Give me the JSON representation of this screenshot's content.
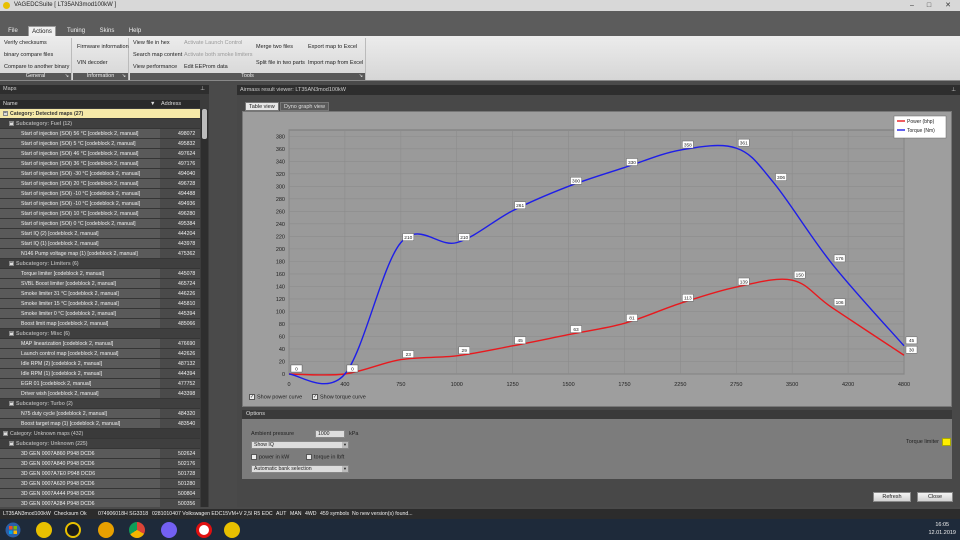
{
  "window": {
    "title": "VAGEDCSuite [ LT35AN3mod100kW ]",
    "controls": [
      "–",
      "□",
      "✕"
    ]
  },
  "ribbon": {
    "tabs": [
      {
        "label": "File",
        "active": false
      },
      {
        "label": "Actions",
        "active": true
      },
      {
        "label": "Tuning",
        "active": false
      },
      {
        "label": "Skins",
        "active": false
      },
      {
        "label": "Help",
        "active": false
      }
    ],
    "general": {
      "label": "General",
      "items": [
        "Verify checksums",
        "binary compare files",
        "Compare to another binary"
      ]
    },
    "information": {
      "label": "Information",
      "items": [
        "Firmware information",
        "VIN decoder"
      ]
    },
    "tools": {
      "label": "Tools",
      "col1": [
        "View file in hex",
        "Search map content",
        "View performance"
      ],
      "col2": [
        "Activate Launch Control",
        "Activate both smoke limiters",
        "Edit EEProm data"
      ],
      "col3": [
        "Merge two files",
        "Split file in two parts"
      ],
      "col4": [
        "Export map to Excel",
        "Import map from Excel"
      ]
    }
  },
  "maps_panel": {
    "title": "Maps",
    "col_name": "Name",
    "col_address": "Address",
    "rows": [
      {
        "type": "category",
        "label": "Category: Detected maps (27)",
        "hl": true
      },
      {
        "type": "subcat",
        "label": "Subcategory: Fuel (12)"
      },
      {
        "type": "item",
        "name": "Start of injection (SOI) 56 °C [codeblock 2, manual]",
        "address": "498072"
      },
      {
        "type": "item",
        "name": "Start of injection (SOI) 5 °C [codeblock 2, manual]",
        "address": "495832"
      },
      {
        "type": "item",
        "name": "Start of injection (SOI) 46 °C [codeblock 2, manual]",
        "address": "497624"
      },
      {
        "type": "item",
        "name": "Start of injection (SOI) 36 °C [codeblock 2, manual]",
        "address": "497176"
      },
      {
        "type": "item",
        "name": "Start of injection (SOI) -30 °C [codeblock 2, manual]",
        "address": "494040"
      },
      {
        "type": "item",
        "name": "Start of injection (SOI) 20 °C [codeblock 2, manual]",
        "address": "496728"
      },
      {
        "type": "item",
        "name": "Start of injection (SOI) -10 °C [codeblock 2, manual]",
        "address": "494488"
      },
      {
        "type": "item",
        "name": "Start of injection (SOI) -10 °C [codeblock 2, manual]",
        "address": "494936"
      },
      {
        "type": "item",
        "name": "Start of injection (SOI) 10 °C [codeblock 2, manual]",
        "address": "496280"
      },
      {
        "type": "item",
        "name": "Start of injection (SOI) 0 °C [codeblock 2, manual]",
        "address": "495384"
      },
      {
        "type": "item",
        "name": "Start IQ (2) [codeblock 2, manual]",
        "address": "444204"
      },
      {
        "type": "item",
        "name": "Start IQ (1) [codeblock 2, manual]",
        "address": "443978"
      },
      {
        "type": "item",
        "name": "N146 Pump voltage map (1) [codeblock 2, manual]",
        "address": "475362"
      },
      {
        "type": "subcat",
        "label": "Subcategory: Limiters (6)"
      },
      {
        "type": "item",
        "name": "Torque limiter [codeblock 2, manual]",
        "address": "445078"
      },
      {
        "type": "item",
        "name": "SVBL Boost limiter [codeblock 2, manual]",
        "address": "465724"
      },
      {
        "type": "item",
        "name": "Smoke limiter 31 °C [codeblock 2, manual]",
        "address": "446226"
      },
      {
        "type": "item",
        "name": "Smoke limiter 15 °C [codeblock 2, manual]",
        "address": "445810"
      },
      {
        "type": "item",
        "name": "Smoke limiter 0 °C [codeblock 2, manual]",
        "address": "445394"
      },
      {
        "type": "item",
        "name": "Boost limit map [codeblock 2, manual]",
        "address": "485066"
      },
      {
        "type": "subcat",
        "label": "Subcategory: Misc (6)"
      },
      {
        "type": "item",
        "name": "MAP linearization [codeblock 2, manual]",
        "address": "476690"
      },
      {
        "type": "item",
        "name": "Launch control map [codeblock 2, manual]",
        "address": "442626"
      },
      {
        "type": "item",
        "name": "Idle RPM (2) [codeblock 2, manual]",
        "address": "487132"
      },
      {
        "type": "item",
        "name": "Idle RPM (1) [codeblock 2, manual]",
        "address": "444394"
      },
      {
        "type": "item",
        "name": "EGR 01 [codeblock 2, manual]",
        "address": "477752"
      },
      {
        "type": "item",
        "name": "Driver wish [codeblock 2, manual]",
        "address": "443398"
      },
      {
        "type": "subcat",
        "label": "Subcategory: Turbo (2)"
      },
      {
        "type": "item",
        "name": "N75 duty cycle [codeblock 2, manual]",
        "address": "484320"
      },
      {
        "type": "item",
        "name": "Boost target map (1) [codeblock 2, manual]",
        "address": "483540"
      },
      {
        "type": "category",
        "label": "Category: Unknown maps (432)",
        "hl": false
      },
      {
        "type": "subcat",
        "label": "Subcategory: Unknown (225)"
      },
      {
        "type": "item",
        "name": "3D GEN 0007A860 P948 DCD6",
        "address": "502624"
      },
      {
        "type": "item",
        "name": "3D GEN 0007A840 P948 DCD6",
        "address": "502176"
      },
      {
        "type": "item",
        "name": "3D GEN 0007A7E0 P948 DCD6",
        "address": "501728"
      },
      {
        "type": "item",
        "name": "3D GEN 0007A620 P948 DCD6",
        "address": "501280"
      },
      {
        "type": "item",
        "name": "3D GEN 0007A444 P948 DCD6",
        "address": "500804"
      },
      {
        "type": "item",
        "name": "3D GEN 0007A284 P948 DCD6",
        "address": "500356"
      }
    ]
  },
  "viewer": {
    "title": "Airmass result viewer: LT35AN3mod100kW",
    "tabs": [
      {
        "label": "Table view",
        "active": true
      },
      {
        "label": "Dyno graph view",
        "active": false
      }
    ],
    "show_power_label": "Show power curve",
    "show_torque_label": "Show torque curve",
    "options_title": "Options",
    "ambient_label": "Ambient pressure",
    "ambient_value": "1000",
    "ambient_unit": "kPa",
    "show_iq_value": "Show IQ",
    "power_kw_label": "power in kW",
    "torque_lbft_label": "torque in lbft",
    "bank_value": "Automatic bank selection",
    "torque_limiter_label": "Torque limiter",
    "torque_limiter_color": "#ffee00",
    "refresh_label": "Refresh",
    "close_label": "Close"
  },
  "chart_data": {
    "type": "line",
    "x": [
      0,
      400,
      500,
      750,
      1000,
      1250,
      1500,
      1750,
      2250,
      2500,
      3000,
      3500,
      4200,
      4800
    ],
    "power_x": [
      0,
      400,
      750,
      1000,
      1250,
      1500,
      1750,
      2250,
      2750,
      3500,
      4000,
      4800
    ],
    "torque_x": [
      0,
      400,
      750,
      1000,
      1250,
      1500,
      1750,
      2250,
      2750,
      3250,
      4000,
      4800
    ],
    "xticks": [
      "0",
      "400",
      "750",
      "1000",
      "1250",
      "1500",
      "1750",
      "2250",
      "2750",
      "3500",
      "4200",
      "4800"
    ],
    "yticks": [
      "0",
      "20",
      "40",
      "60",
      "80",
      "100",
      "120",
      "140",
      "160",
      "180",
      "200",
      "220",
      "240",
      "260",
      "280",
      "300",
      "320",
      "340",
      "360",
      "380"
    ],
    "ylim": [
      0,
      390
    ],
    "series": [
      {
        "name": "Power (bhp)",
        "color": "#e8191e",
        "values": [
          0,
          0,
          23,
          29,
          45,
          63,
          81,
          113,
          139,
          150,
          106,
          30
        ],
        "labels": [
          "0",
          "0",
          "23",
          "29",
          "45",
          "63",
          "81",
          "113",
          "139",
          "150",
          "106",
          "30"
        ]
      },
      {
        "name": "Torque (Nm)",
        "color": "#1e1ee8",
        "values": [
          0,
          0,
          210,
          210,
          261,
          300,
          330,
          358,
          361,
          306,
          176,
          45
        ],
        "labels": [
          "0",
          "0",
          "210",
          "210",
          "261",
          "300",
          "330",
          "358",
          "361",
          "306",
          "176",
          "45"
        ]
      }
    ],
    "legend": "top-right"
  },
  "statusbar": {
    "file": "LT35AN3mod100kW",
    "checksum": "Checksum Ok",
    "ecu": "074906018H SG3318",
    "ecu_info": "0281010407 Volkswagen EDC15VM+V 2,5l R5 EDC",
    "aut": "AUT",
    "man": "MAN",
    "wd": "4WD",
    "symbols": "459 symbols",
    "version": "No new version(s) found..."
  },
  "taskbar": {
    "time": "16:05",
    "date": "12.01.2019"
  }
}
